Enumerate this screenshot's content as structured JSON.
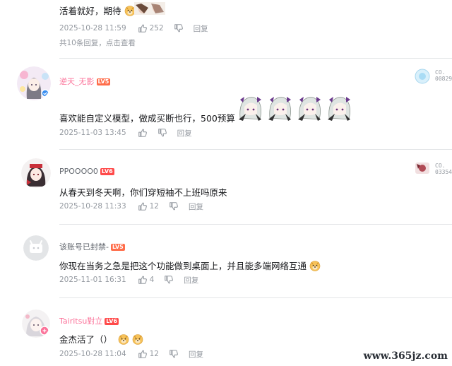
{
  "comments": [
    {
      "id": "c0",
      "content": "活着就好，期待",
      "time": "2025-10-28 11:59",
      "likes": "252",
      "reply_label": "回复",
      "sub_summary": "共10条回复，点击查看"
    },
    {
      "id": "c1",
      "username": "逆天_无影",
      "level": "LV5",
      "name_color": "#fb7299",
      "content": "喜欢能自定义模型，做成买断也行，500预算",
      "time": "2025-11-03 13:45",
      "likes": "",
      "reply_label": "回复",
      "medal_id": "CO. 00829"
    },
    {
      "id": "c2",
      "username": "PPOOOO0",
      "level": "LV6",
      "name_color": "#61666d",
      "content": "从春天到冬天啊，你们穿短袖不上班吗原来",
      "time": "2025-10-28 11:33",
      "likes": "12",
      "reply_label": "回复",
      "medal_id": "CO. 03354"
    },
    {
      "id": "c3",
      "username": "该账号已封禁-",
      "level": "LV5",
      "name_color": "#61666d",
      "content": "你现在当务之急是把这个功能做到桌面上，并且能多端网络互通",
      "time": "2025-11-01 16:31",
      "likes": "4",
      "reply_label": "回复"
    },
    {
      "id": "c4",
      "username": "Tairitsu對立",
      "level": "LV6",
      "name_color": "#fb7299",
      "content": "金杰活了（）",
      "time": "2025-10-28 11:04",
      "likes": "12",
      "reply_label": "回复"
    }
  ],
  "colors": {
    "lv5": "#ff6d4a",
    "lv6": "#ff4a4a",
    "meta": "#9499a0"
  },
  "icons": {
    "like": "thumb-up-icon",
    "dislike": "thumb-down-icon",
    "emoji": "doge-emoji-icon"
  },
  "watermark": "www.365jz.com"
}
